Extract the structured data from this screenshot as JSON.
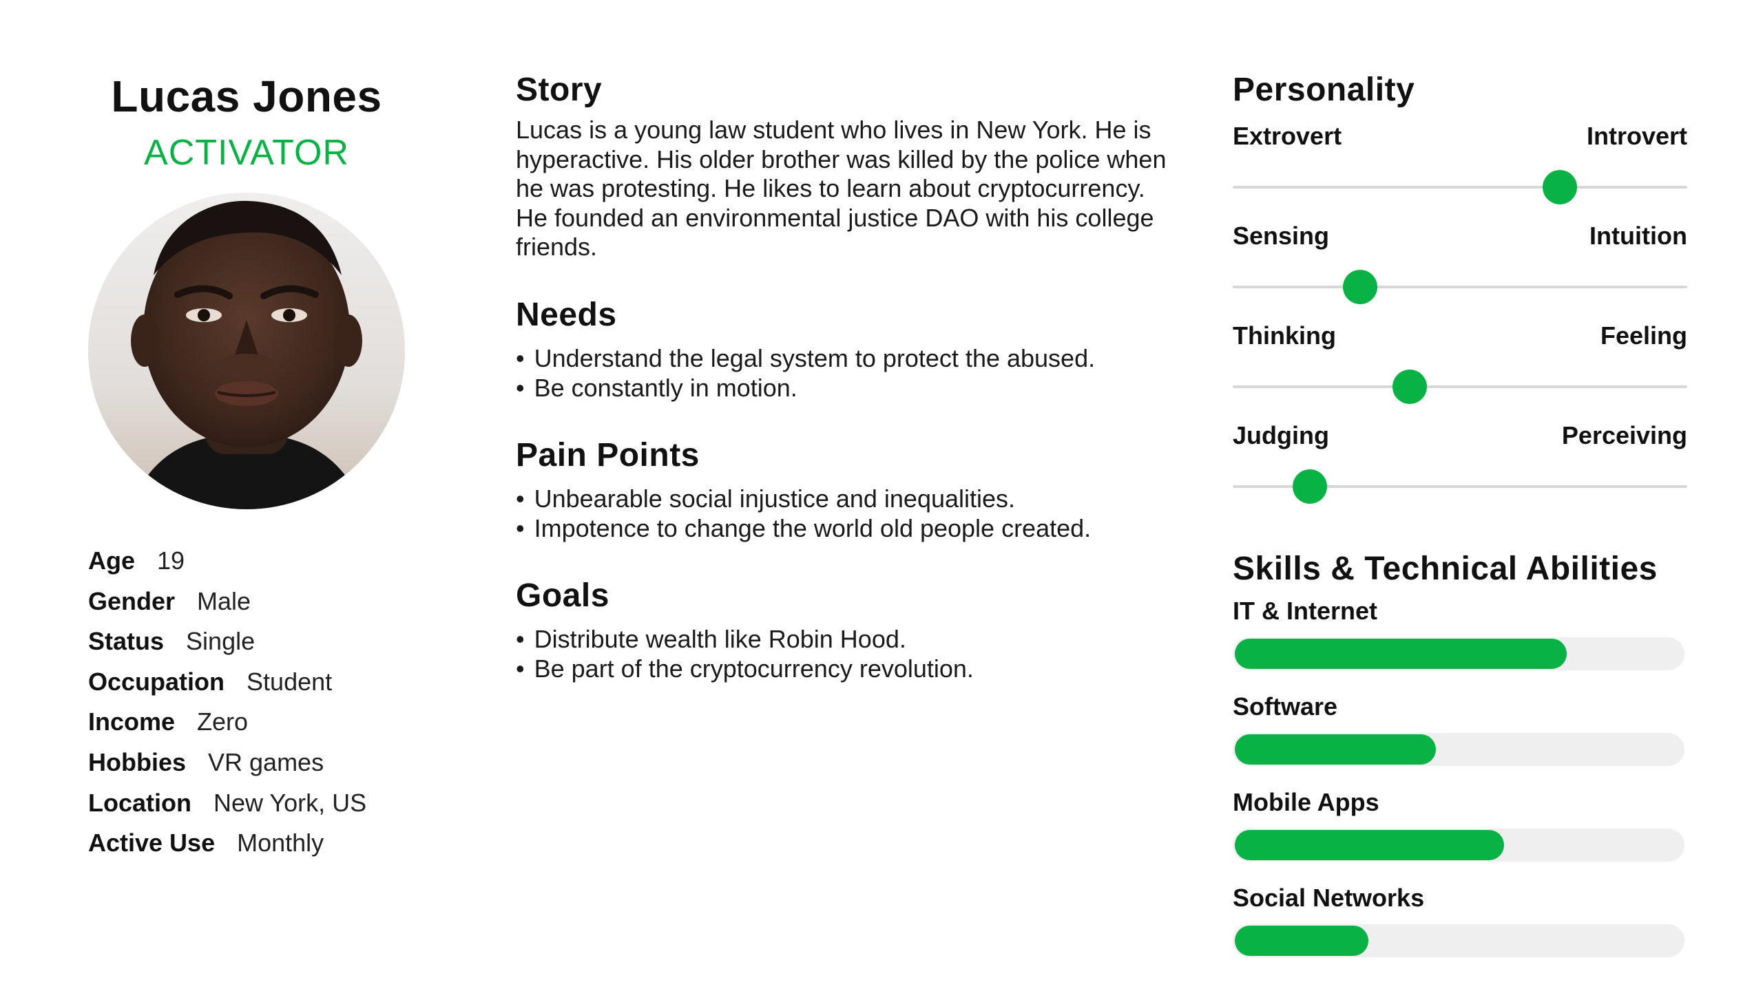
{
  "persona": {
    "name": "Lucas Jones",
    "type": "ACTIVATOR"
  },
  "details": [
    {
      "key": "Age",
      "value": "19"
    },
    {
      "key": "Gender",
      "value": "Male"
    },
    {
      "key": "Status",
      "value": "Single"
    },
    {
      "key": "Occupation",
      "value": "Student"
    },
    {
      "key": "Income",
      "value": "Zero"
    },
    {
      "key": "Hobbies",
      "value": "VR games"
    },
    {
      "key": "Location",
      "value": "New York, US"
    },
    {
      "key": "Active Use",
      "value": "Monthly"
    }
  ],
  "story": {
    "title": "Story",
    "text": "Lucas is a young law student who lives in New York. He is hyperactive. His older brother was killed by the police when he was protesting. He likes to learn about cryptocurrency. He founded an environmental justice DAO with his college friends."
  },
  "needs": {
    "title": "Needs",
    "items": [
      "Understand the legal system to protect the abused.",
      "Be constantly in motion."
    ]
  },
  "pain_points": {
    "title": "Pain Points",
    "items": [
      "Unbearable social injustice and inequalities.",
      "Impotence to change the world old people created."
    ]
  },
  "goals": {
    "title": "Goals",
    "items": [
      "Distribute wealth like Robin Hood.",
      "Be part of the cryptocurrency revolution."
    ]
  },
  "personality": {
    "title": "Personality",
    "traits": [
      {
        "left": "Extrovert",
        "right": "Introvert",
        "value": 0.72
      },
      {
        "left": "Sensing",
        "right": "Intuition",
        "value": 0.28
      },
      {
        "left": "Thinking",
        "right": "Feeling",
        "value": 0.39
      },
      {
        "left": "Judging",
        "right": "Perceiving",
        "value": 0.17
      }
    ]
  },
  "skills": {
    "title": "Skills & Technical Abilities",
    "items": [
      {
        "label": "IT & Internet",
        "value": 0.74
      },
      {
        "label": "Software",
        "value": 0.45
      },
      {
        "label": "Mobile Apps",
        "value": 0.6
      },
      {
        "label": "Social Networks",
        "value": 0.3
      }
    ]
  },
  "colors": {
    "accent": "#08b244",
    "track": "#d7d7d7",
    "skill_track": "#efefef"
  },
  "icons": {
    "avatar": "portrait-photo"
  }
}
